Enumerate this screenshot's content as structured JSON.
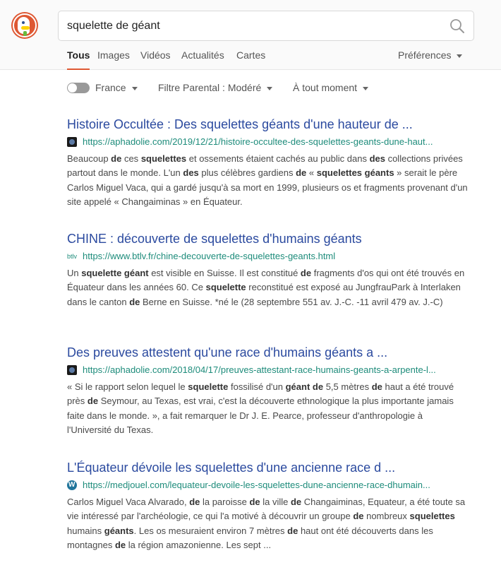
{
  "search": {
    "query": "squelette de géant"
  },
  "tabs": [
    {
      "label": "Tous",
      "active": true
    },
    {
      "label": "Images"
    },
    {
      "label": "Vidéos"
    },
    {
      "label": "Actualités"
    },
    {
      "label": "Cartes"
    }
  ],
  "preferences_label": "Préférences",
  "filters": {
    "region": "France",
    "safe_search": "Filtre Parental : Modéré",
    "time": "À tout moment"
  },
  "colors": {
    "accent": "#de5833",
    "title_link": "#2b4a9f",
    "url": "#1e8c7b"
  },
  "results": [
    {
      "title": "Histoire Occultée : Des squelettes géants d'une hauteur de ...",
      "url": "https://aphadolie.com/2019/12/21/histoire-occultee-des-squelettes-geants-dune-haut...",
      "favicon": "dark-circle-icon",
      "snippet": [
        {
          "t": "Beaucoup "
        },
        {
          "t": "de",
          "b": true
        },
        {
          "t": " ces "
        },
        {
          "t": "squelettes",
          "b": true
        },
        {
          "t": " et ossements étaient cachés au public dans "
        },
        {
          "t": "des",
          "b": true
        },
        {
          "t": " collections privées partout dans le monde. L'un "
        },
        {
          "t": "des",
          "b": true
        },
        {
          "t": " plus célèbres gardiens "
        },
        {
          "t": "de",
          "b": true
        },
        {
          "t": " « "
        },
        {
          "t": "squelettes géants",
          "b": true
        },
        {
          "t": " » serait le père Carlos Miguel Vaca, qui a gardé jusqu'à sa mort en 1999, plusieurs os et fragments provenant d'un site appelé « Changaiminas » en Équateur."
        }
      ]
    },
    {
      "title": "CHINE : découverte de squelettes d'humains géants",
      "url": "https://www.btlv.fr/chine-decouverte-de-squelettes-geants.html",
      "favicon": "btlv-icon",
      "favicon_text": "btlv",
      "snippet": [
        {
          "t": "Un "
        },
        {
          "t": "squelette géant",
          "b": true
        },
        {
          "t": " est visible en Suisse. Il est constitué "
        },
        {
          "t": "de",
          "b": true
        },
        {
          "t": " fragments d'os qui ont été trouvés en Équateur dans les années 60. Ce "
        },
        {
          "t": "squelette",
          "b": true
        },
        {
          "t": " reconstitué est exposé au JungfrauPark à Interlaken dans le canton "
        },
        {
          "t": "de",
          "b": true
        },
        {
          "t": " Berne en Suisse. *né le (28 septembre 551 av. J.-C. -11 avril 479 av. J.-C)"
        }
      ]
    },
    {
      "title": "Des preuves attestent qu'une race d'humains géants a ...",
      "url": "https://aphadolie.com/2018/04/17/preuves-attestant-race-humains-geants-a-arpente-l...",
      "favicon": "dark-circle-icon",
      "snippet": [
        {
          "t": "« Si le rapport selon lequel le "
        },
        {
          "t": "squelette",
          "b": true
        },
        {
          "t": " fossilisé d'un "
        },
        {
          "t": "géant de",
          "b": true
        },
        {
          "t": " 5,5 mètres "
        },
        {
          "t": "de",
          "b": true
        },
        {
          "t": " haut a été trouvé près "
        },
        {
          "t": "de",
          "b": true
        },
        {
          "t": " Seymour, au Texas, est vrai, c'est la découverte ethnologique la plus importante jamais faite dans le monde. », a fait remarquer le Dr J. E. Pearce, professeur d'anthropologie à l'Université du Texas."
        }
      ]
    },
    {
      "title": "L'Équateur dévoile les squelettes d'une ancienne race d ...",
      "url": "https://medjouel.com/lequateur-devoile-les-squelettes-dune-ancienne-race-dhumain...",
      "favicon": "wordpress-icon",
      "snippet": [
        {
          "t": "Carlos Miguel Vaca Alvarado, "
        },
        {
          "t": "de",
          "b": true
        },
        {
          "t": " la paroisse "
        },
        {
          "t": "de",
          "b": true
        },
        {
          "t": " la ville "
        },
        {
          "t": "de",
          "b": true
        },
        {
          "t": " Changaiminas, Equateur, a été toute sa vie intéressé par l'archéologie, ce qui l'a motivé à découvrir un groupe "
        },
        {
          "t": "de",
          "b": true
        },
        {
          "t": " nombreux "
        },
        {
          "t": "squelettes",
          "b": true
        },
        {
          "t": " humains "
        },
        {
          "t": "géants",
          "b": true
        },
        {
          "t": ". Les os mesuraient environ 7 mètres "
        },
        {
          "t": "de",
          "b": true
        },
        {
          "t": " haut ont été découverts dans les montagnes "
        },
        {
          "t": "de",
          "b": true
        },
        {
          "t": " la région amazonienne. Les sept ..."
        }
      ]
    }
  ]
}
